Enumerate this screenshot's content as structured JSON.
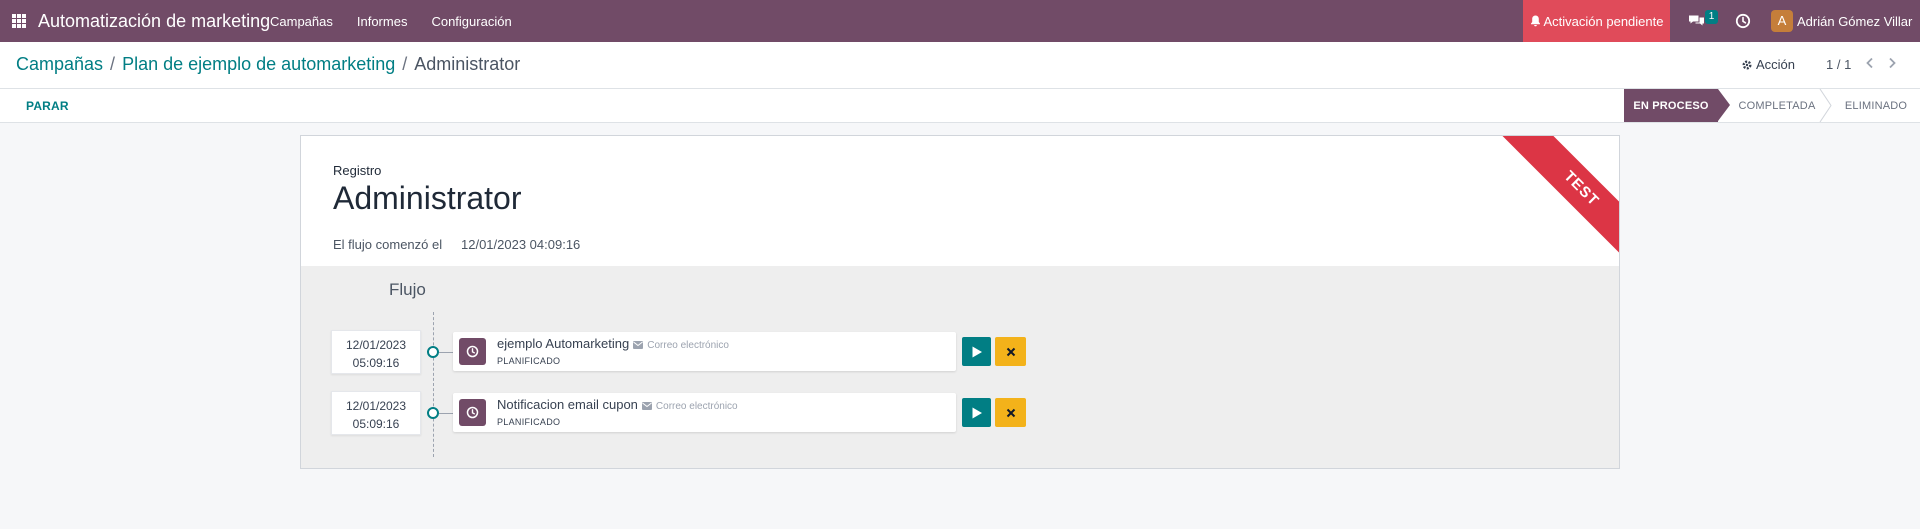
{
  "navbar": {
    "app_title": "Automatización de marketing",
    "menu": [
      "Campañas",
      "Informes",
      "Configuración"
    ],
    "activation": "Activación pendiente",
    "chat_count": "1",
    "avatar_letter": "A",
    "user": "Adrián Gómez Villar",
    "colors": {
      "brand": "#714b67",
      "alert": "#e04b5a",
      "accent": "#017e84"
    }
  },
  "breadcrumb": {
    "items": [
      "Campañas",
      "Plan de ejemplo de automarketing"
    ],
    "current": "Administrator",
    "separator": "/"
  },
  "toolbar": {
    "action": "Acción",
    "pager": "1 / 1"
  },
  "statusbar": {
    "stop": "PARAR",
    "stages": [
      "EN PROCESO",
      "COMPLETADA",
      "ELIMINADO"
    ],
    "active_stage": "EN PROCESO"
  },
  "record": {
    "ribbon": "TEST",
    "label": "Registro",
    "title": "Administrator",
    "started_label": "El flujo comenzó el",
    "started_value": "12/01/2023 04:09:16"
  },
  "flow": {
    "title": "Flujo",
    "activities": [
      {
        "date": "12/01/2023",
        "time": "05:09:16",
        "name": "ejemplo Automarketing",
        "type": "Correo electrónico",
        "state": "PLANIFICADO"
      },
      {
        "date": "12/01/2023",
        "time": "05:09:16",
        "name": "Notificacion email cupon",
        "type": "Correo electrónico",
        "state": "PLANIFICADO"
      }
    ]
  }
}
